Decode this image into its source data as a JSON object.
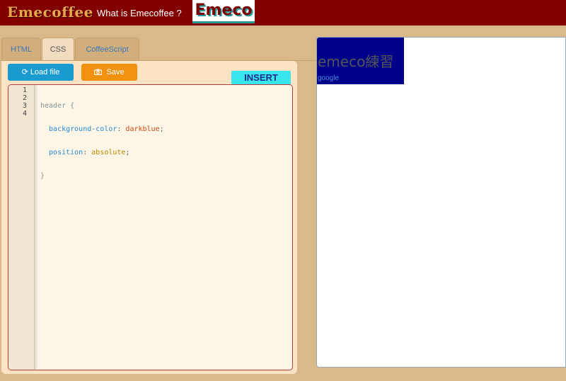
{
  "header": {
    "brand": "Emecoffee",
    "what_link": "What is Emecoffee ?",
    "logo_text": "Emeco"
  },
  "tabs": [
    {
      "label": "HTML",
      "active": false
    },
    {
      "label": "CSS",
      "active": true
    },
    {
      "label": "CoffeeScript",
      "active": false
    }
  ],
  "toolbar": {
    "load_label": "Load file",
    "load_icon": "refresh-icon",
    "save_label": "Save",
    "save_icon": "camera-icon",
    "insert_label": "INSERT"
  },
  "editor": {
    "line_numbers": [
      "1",
      "2",
      "3",
      "4"
    ],
    "lines": [
      "header {",
      "  background-color: darkblue;",
      "  position: absolute;",
      "}"
    ]
  },
  "preview": {
    "title": "emeco練習",
    "link": "google",
    "header_bg": "#00008b"
  },
  "colors": {
    "topbar": "#820000",
    "page_bg": "#d9b98a",
    "panel_bg": "#fce3c3",
    "load_btn": "#1a9bd0",
    "save_btn": "#f0920f",
    "insert_btn": "#3ae6ee"
  }
}
